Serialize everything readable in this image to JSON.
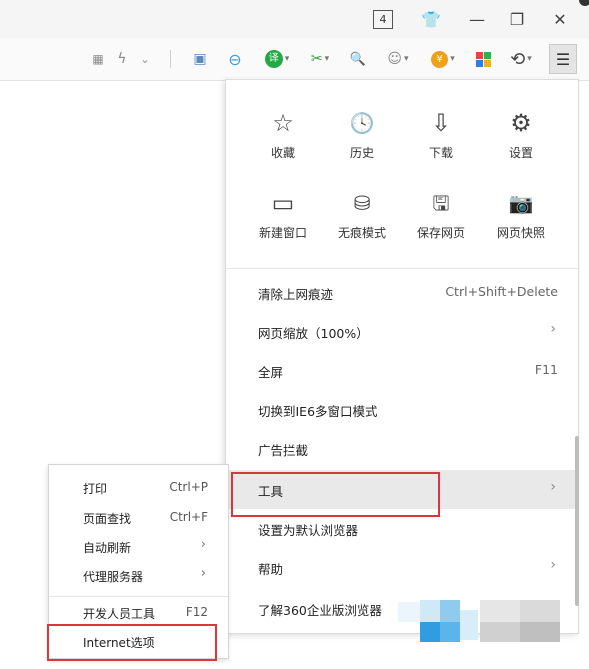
{
  "titlebar": {
    "tab_count": "4",
    "icons": [
      "shirt-icon",
      "minimize-icon",
      "restore-icon",
      "close-icon"
    ],
    "glyphs": {
      "shirt": "👕",
      "minimize": "—",
      "restore": "❐",
      "close": "✕"
    }
  },
  "toolbar": {
    "glyphs": {
      "qr": "▦",
      "flash": "ϟ",
      "dropdown": "⌄",
      "screenshot": "▣",
      "minus": "⊖",
      "translate": "译",
      "scissors": "✂",
      "search": "🔍",
      "game": "☺",
      "coin": "¥",
      "apps": "■",
      "undo": "⟲",
      "menu": "☰"
    },
    "colors": {
      "translate": "#22aa44",
      "scissors": "#2e9a3a",
      "search": "#1f74d6",
      "coin": "#f0a020",
      "apps": "#f04040",
      "minus": "#3aa0e0"
    }
  },
  "menu": {
    "grid": [
      {
        "icon": "☆",
        "label": "收藏"
      },
      {
        "icon": "🕓",
        "label": "历史"
      },
      {
        "icon": "⇩",
        "label": "下载"
      },
      {
        "icon": "⚙",
        "label": "设置"
      },
      {
        "icon": "▭",
        "label": "新建窗口"
      },
      {
        "icon": "⛁",
        "label": "无痕模式"
      },
      {
        "icon": "🖫",
        "label": "保存网页"
      },
      {
        "icon": "📷",
        "label": "网页快照"
      }
    ],
    "items": [
      {
        "label": "清除上网痕迹",
        "shortcut": "Ctrl+Shift+Delete",
        "arrow": ""
      },
      {
        "label": "网页缩放（100%）",
        "shortcut": "",
        "arrow": "›"
      },
      {
        "label": "全屏",
        "shortcut": "F11",
        "arrow": ""
      },
      {
        "label": "切换到IE6多窗口模式",
        "shortcut": "",
        "arrow": ""
      },
      {
        "label": "广告拦截",
        "shortcut": "",
        "arrow": ""
      },
      {
        "label": "工具",
        "shortcut": "",
        "arrow": "›"
      },
      {
        "label": "设置为默认浏览器",
        "shortcut": "",
        "arrow": ""
      },
      {
        "label": "帮助",
        "shortcut": "",
        "arrow": "›"
      },
      {
        "label": "了解360企业版浏览器",
        "shortcut": "",
        "arrow": ""
      }
    ]
  },
  "submenu": {
    "items": [
      {
        "label": "打印",
        "shortcut": "Ctrl+P",
        "arrow": ""
      },
      {
        "label": "页面查找",
        "shortcut": "Ctrl+F",
        "arrow": ""
      },
      {
        "label": "自动刷新",
        "shortcut": "",
        "arrow": "›"
      },
      {
        "label": "代理服务器",
        "shortcut": "",
        "arrow": "›"
      },
      {
        "label": "开发人员工具",
        "shortcut": "F12",
        "arrow": ""
      },
      {
        "label": "Internet选项",
        "shortcut": "",
        "arrow": ""
      }
    ]
  },
  "colors": {
    "highlight_box": "#d9363e",
    "hover_row": "#e9e9e9",
    "mosaic": [
      "#cfe9f7",
      "#8fcbee",
      "#2f9ee0",
      "#e6e6e6",
      "#d0d0d0",
      "#bfbfbf"
    ]
  }
}
